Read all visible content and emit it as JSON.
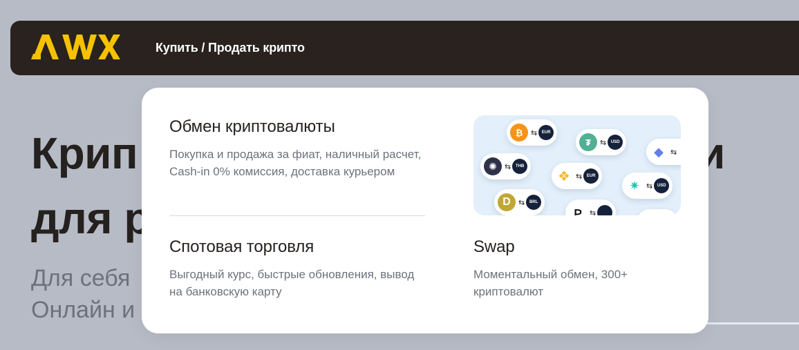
{
  "header": {
    "logo_text": "AWX",
    "nav_link": "Купить / Продать крипто"
  },
  "hero": {
    "title_line1": "Крип",
    "title_line2": "для р",
    "title_right": "и",
    "sub_line1": "Для себя",
    "sub_line2": "Онлайн и"
  },
  "dropdown": {
    "exchange": {
      "title": "Обмен криптовалюты",
      "description": "Покупка и продажа за фиат, наличный расчет, Cash-in 0% комиссия, доставка курьером"
    },
    "spot": {
      "title": "Спотовая торговля",
      "description": "Выгодный курс, быстрые обновления, вывод на банковскую карту"
    },
    "swap": {
      "title": "Swap",
      "description": "Моментальный обмен, 300+ криптовалют",
      "pairs": [
        {
          "coin": "bitcoin-icon",
          "fiat": "EUR",
          "color": "#f7931a"
        },
        {
          "coin": "tether-icon",
          "fiat": "USD",
          "color": "#50af95"
        },
        {
          "coin": "ethereum-icon",
          "fiat": "",
          "color": "#627eea"
        },
        {
          "coin": "cosmos-icon",
          "fiat": "THB",
          "color": "#2e3148"
        },
        {
          "coin": "binance-icon",
          "fiat": "EUR",
          "color": "#f3ba2f"
        },
        {
          "coin": "cardano-icon",
          "fiat": "USD",
          "color": "#1fc7b5"
        },
        {
          "coin": "dogecoin-icon",
          "fiat": "BRL",
          "color": "#c2a633"
        },
        {
          "coin": "polkadot-icon",
          "fiat": "",
          "color": "#111111"
        }
      ]
    }
  },
  "colors": {
    "backdrop": "#b7bbc6",
    "header_bg": "#29221f",
    "logo": "#f6c200",
    "panel": "#ffffff",
    "swap_image_bg": "#e3effa"
  }
}
